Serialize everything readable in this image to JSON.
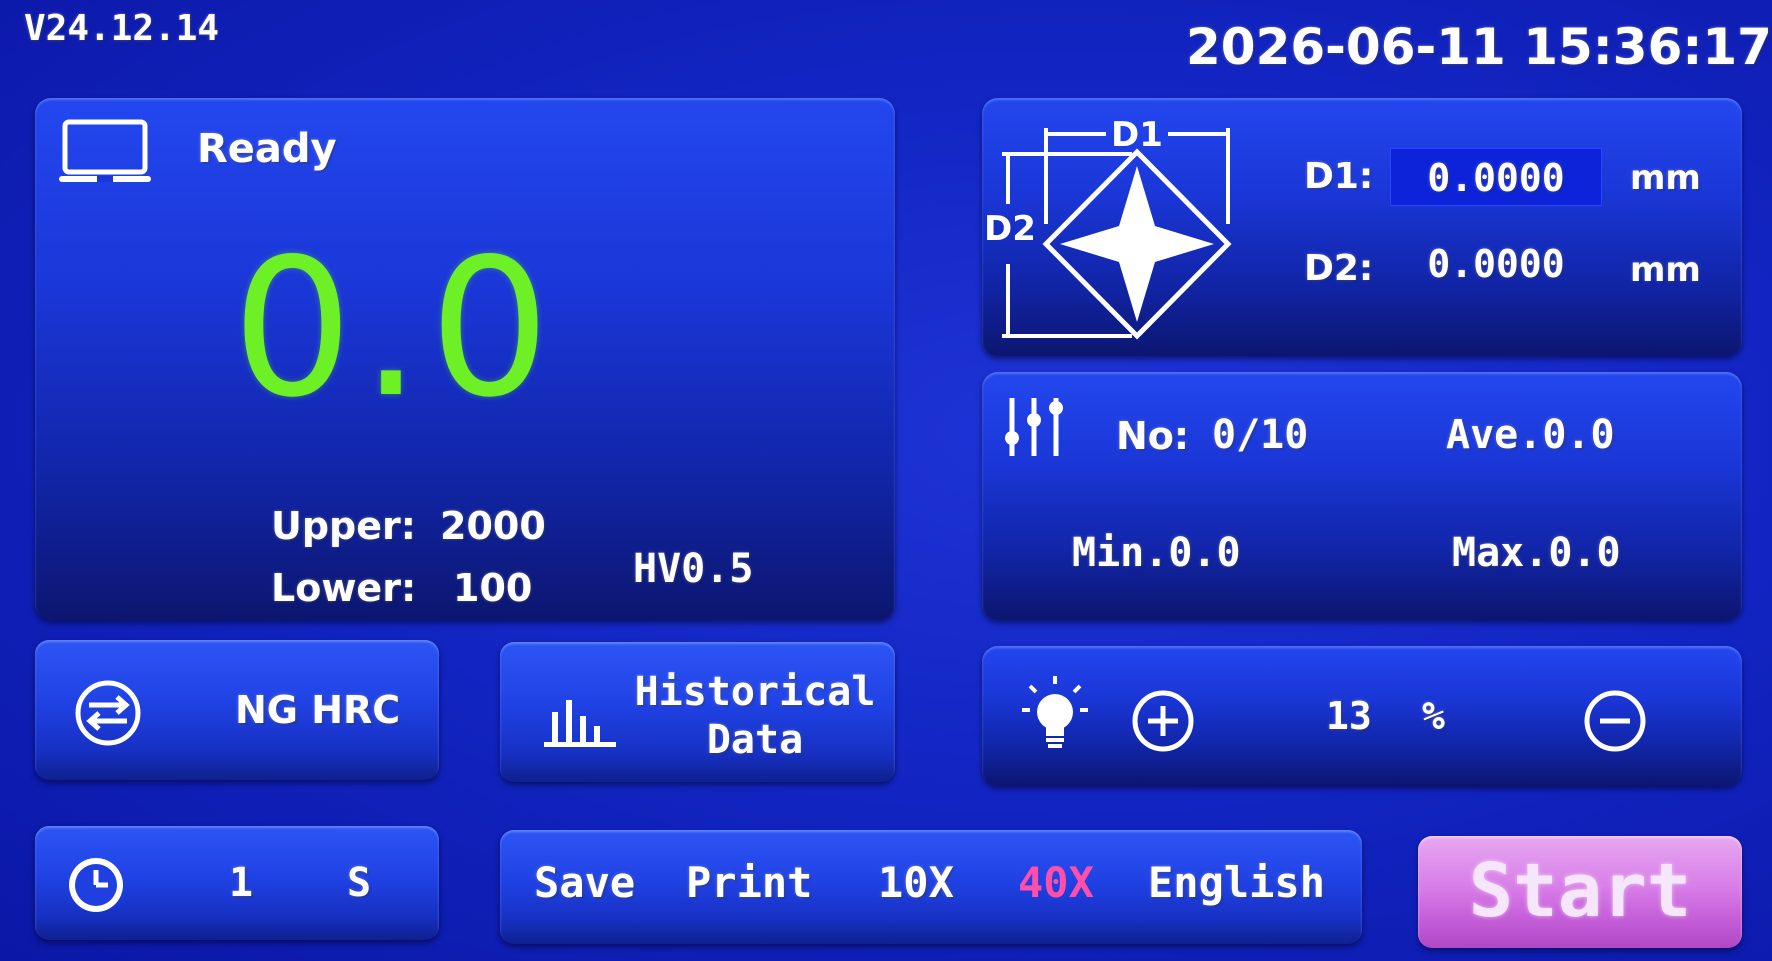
{
  "header": {
    "version": "V24.12.14",
    "datetime": "2026-06-11  15:36:17"
  },
  "main": {
    "status": "Ready",
    "hardness": "0.0",
    "upper_label": "Upper:",
    "upper_value": "2000",
    "lower_label": "Lower:",
    "lower_value": "100",
    "scale": "HV0.5",
    "accent_color": "#6ef027"
  },
  "indent": {
    "diagram_d1": "D1",
    "diagram_d2": "D2",
    "d1_label": "D1:",
    "d1_value": "0.0000",
    "d1_unit": "mm",
    "d2_label": "D2:",
    "d2_value": "0.0000",
    "d2_unit": "mm"
  },
  "stats": {
    "no_label": "No:",
    "no_value": "0/10",
    "ave": "Ave.0.0",
    "min": "Min.0.0",
    "max": "Max.0.0"
  },
  "buttons": {
    "ng_hrc": "NG HRC",
    "historical_data": "Historical Data",
    "start": "Start",
    "start_color": "#d87ee8"
  },
  "brightness": {
    "value": "13",
    "unit": "%"
  },
  "timer": {
    "value": "1",
    "unit": "S"
  },
  "toolbar": {
    "save": "Save",
    "print": "Print",
    "zoom10": "10X",
    "zoom40": "40X",
    "language": "English",
    "active_color": "#ff4fa8"
  },
  "icons": {
    "monitor": "monitor-icon",
    "sliders": "sliders-icon",
    "swap": "swap-icon",
    "bar_chart": "bar-chart-icon",
    "bulb": "bulb-icon",
    "plus": "plus-circle-icon",
    "minus": "minus-circle-icon",
    "clock": "clock-icon"
  }
}
